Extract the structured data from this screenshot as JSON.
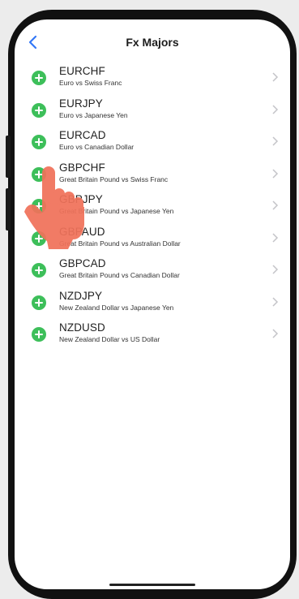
{
  "nav": {
    "title": "Fx Majors",
    "back_icon": "chevron-left-icon"
  },
  "accent_color": "#3478f6",
  "add_color": "#3dbf5a",
  "pairs": [
    {
      "symbol": "EURCHF",
      "description": "Euro vs Swiss Franc"
    },
    {
      "symbol": "EURJPY",
      "description": "Euro vs Japanese Yen"
    },
    {
      "symbol": "EURCAD",
      "description": "Euro vs Canadian Dollar"
    },
    {
      "symbol": "GBPCHF",
      "description": "Great Britain Pound vs Swiss Franc"
    },
    {
      "symbol": "GBPJPY",
      "description": "Great Britain Pound vs Japanese Yen"
    },
    {
      "symbol": "GBPAUD",
      "description": "Great Britain Pound vs Australian Dollar"
    },
    {
      "symbol": "GBPCAD",
      "description": "Great Britain Pound vs Canadian Dollar"
    },
    {
      "symbol": "NZDJPY",
      "description": "New Zealand Dollar vs Japanese Yen"
    },
    {
      "symbol": "NZDUSD",
      "description": "New Zealand Dollar vs US Dollar"
    }
  ]
}
